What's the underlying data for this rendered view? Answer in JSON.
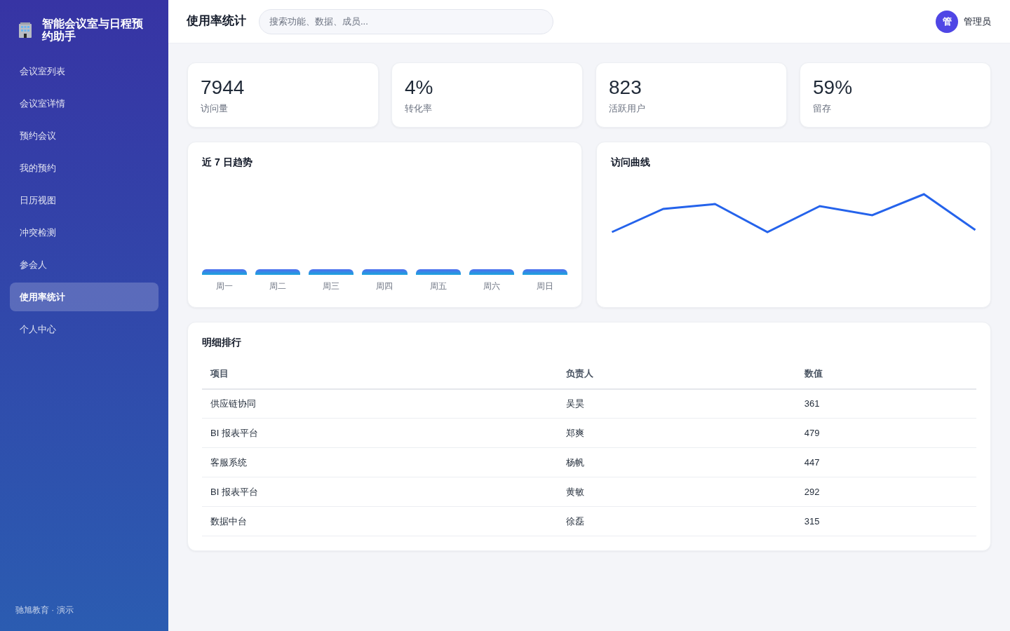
{
  "sidebar": {
    "brand": "智能会议室与日程预约助手",
    "items": [
      {
        "label": "会议室列表",
        "selected": false
      },
      {
        "label": "会议室详情",
        "selected": false
      },
      {
        "label": "预约会议",
        "selected": false
      },
      {
        "label": "我的预约",
        "selected": false
      },
      {
        "label": "日历视图",
        "selected": false
      },
      {
        "label": "冲突检测",
        "selected": false
      },
      {
        "label": "参会人",
        "selected": false
      },
      {
        "label": "使用率统计",
        "selected": true
      },
      {
        "label": "个人中心",
        "selected": false
      }
    ],
    "footer": "驰旭教育 · 演示"
  },
  "header": {
    "title": "使用率统计",
    "search": {
      "placeholder": "搜索功能、数据、成员..."
    },
    "user": {
      "avatar": "管",
      "name": "管理员"
    }
  },
  "stats": [
    {
      "value": "7944",
      "label": "访问量"
    },
    {
      "value": "4%",
      "label": "转化率"
    },
    {
      "value": "823",
      "label": "活跃用户"
    },
    {
      "value": "59%",
      "label": "留存"
    }
  ],
  "trend_chart": {
    "title": "近 7 日趋势",
    "labels": [
      "周一",
      "周二",
      "周三",
      "周四",
      "周五",
      "周六",
      "周日"
    ]
  },
  "visit_chart": {
    "title": "访问曲线"
  },
  "table": {
    "title": "明细排行",
    "columns": [
      "项目",
      "负责人",
      "数值"
    ],
    "rows": [
      [
        "供应链协同",
        "吴昊",
        "361"
      ],
      [
        "BI 报表平台",
        "郑爽",
        "479"
      ],
      [
        "客服系统",
        "杨帆",
        "447"
      ],
      [
        "BI 报表平台",
        "黄敏",
        "292"
      ],
      [
        "数据中台",
        "徐磊",
        "315"
      ]
    ]
  }
}
